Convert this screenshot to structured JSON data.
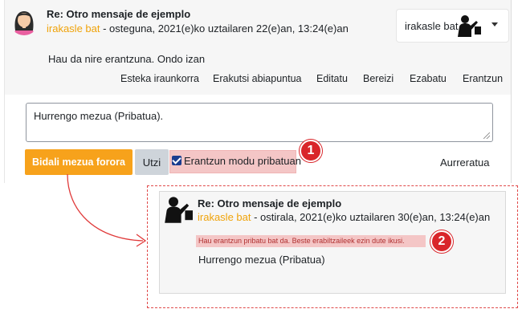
{
  "post": {
    "subject": "Re: Otro mensaje de ejemplo",
    "author": "irakasle bat",
    "date": " - osteguna, 2021(e)ko uztailaren 22(e)an, 13:24(e)an",
    "body": "Hau da nire erantzuna. Ondo izan"
  },
  "user_menu": {
    "name": "irakasle bat"
  },
  "actions": [
    "Esteka iraunkorra",
    "Erakutsi abiapuntua",
    "Editatu",
    "Bereizi",
    "Ezabatu",
    "Erantzun"
  ],
  "reply": {
    "value": "Hurrengo mezua (Pribatua).",
    "send_label": "Bidali mezua forora",
    "cancel_label": "Utzi",
    "private_label": "Erantzun modu pribatuan",
    "private_checked": true,
    "advanced_label": "Aurreratua"
  },
  "badges": [
    "1",
    "2"
  ],
  "preview": {
    "subject": "Re: Otro mensaje de ejemplo",
    "author": "irakasle bat",
    "date": " - ostirala, 2021(e)ko uztailaren 30(e)an, 13:24(e)an",
    "private_notice": "Hau erantzun pribatu bat da. Beste erabiltzaileek ezin dute ikusi.",
    "body": "Hurrengo mezua (Pribatua)"
  },
  "colors": {
    "accent": "#f7a21b",
    "author": "#f0a30a",
    "badge": "#d9252a",
    "highlight": "#f4c6c6"
  },
  "icons": {
    "user_avatar_female": "woman-avatar-icon",
    "teacher_avatar": "teacher-icon",
    "caret": "chevron-down-icon"
  }
}
